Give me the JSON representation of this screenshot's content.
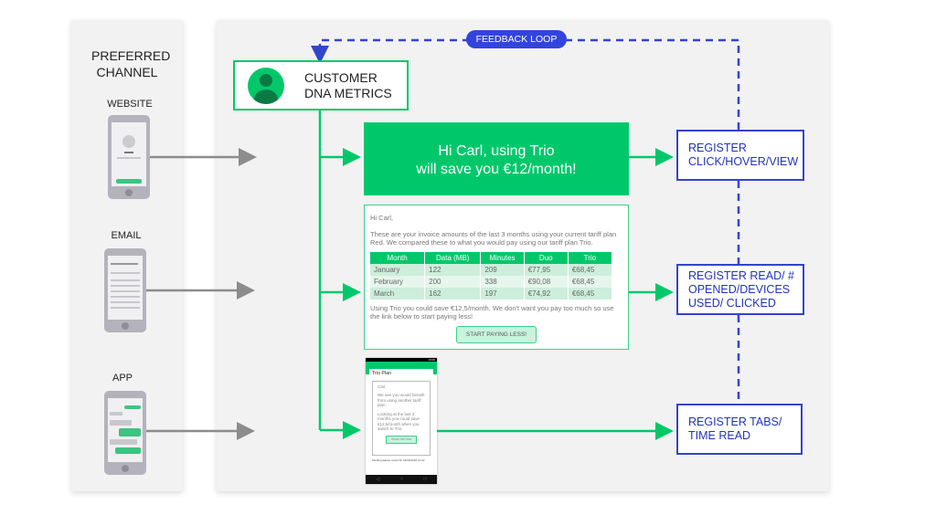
{
  "channels": {
    "title": "PREFERRED CHANNEL",
    "items": [
      {
        "label": "WEBSITE"
      },
      {
        "label": "EMAIL"
      },
      {
        "label": "APP"
      }
    ]
  },
  "feedback": {
    "label": "FEEDBACK LOOP"
  },
  "dna": {
    "title": "CUSTOMER DNA METRICS"
  },
  "banner": {
    "line1": "Hi Carl, using Trio",
    "line2": "will save you €12/month!"
  },
  "email": {
    "greeting": "Hi Carl,",
    "intro": "These are your invoice amounts of the last 3 months using your current tariff plan Red. We compared these to what you would pay using our tariff plan Trio.",
    "columns": [
      "Month",
      "Data (MB)",
      "Minutes",
      "Duo",
      "Trio"
    ],
    "rows": [
      [
        "January",
        "122",
        "209",
        "€77,95",
        "€68,45"
      ],
      [
        "February",
        "200",
        "338",
        "€90,08",
        "€68,45"
      ],
      [
        "March",
        "162",
        "197",
        "€74,92",
        "€68,45"
      ]
    ],
    "outro": "Using Trio you could save €12,5/month. We don't want you pay too much so use the link below to start paying less!",
    "cta": "START PAYING LESS!"
  },
  "app": {
    "time": "13:00",
    "title": "Trio Plan",
    "greeting": "Carl,",
    "p1": "We see you would benefit from using another tariff plan.",
    "p2": "Looking at the last 3 months you could save €12,5/month when you switch to Trio.",
    "cta": "Show me how",
    "footer": "Melding laatste verkocht: 18/06/2018 13:02"
  },
  "registers": [
    {
      "label": "REGISTER CLICK/HOVER/VIEW"
    },
    {
      "label": "REGISTER READ/ # OPENED/DEVICES USED/ CLICKED"
    },
    {
      "label": "REGISTER TABS/ TIME READ"
    }
  ],
  "colors": {
    "green": "#00c86a",
    "blue": "#3344cc",
    "gray": "#8c8c8c"
  }
}
